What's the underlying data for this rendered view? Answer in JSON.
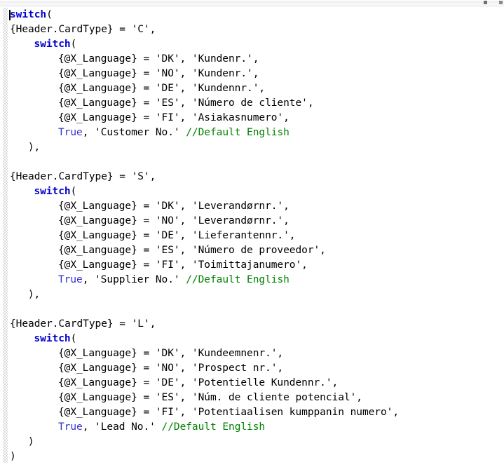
{
  "app": {
    "type": "code-editor",
    "language": "Crystal Reports formula",
    "colors": {
      "background": "#ffffff",
      "text": "#000000",
      "keyword": "#0000d0",
      "boolean": "#3333cc",
      "comment": "#008000",
      "gutter": "#d8d8d8"
    }
  },
  "chrome": {
    "mark_1": "",
    "mark_2": ""
  },
  "editor": {
    "caret_line": 1,
    "caret_column": 1,
    "lines": [
      {
        "n": 1,
        "indent": 0,
        "tokens": [
          {
            "t": "kw",
            "v": "switch"
          },
          {
            "t": "punc",
            "v": "("
          }
        ]
      },
      {
        "n": 2,
        "indent": 0,
        "tokens": [
          {
            "t": "fld",
            "v": "{Header.CardType} = 'C',"
          }
        ]
      },
      {
        "n": 3,
        "indent": 4,
        "tokens": [
          {
            "t": "kw",
            "v": "switch"
          },
          {
            "t": "punc",
            "v": "("
          }
        ]
      },
      {
        "n": 4,
        "indent": 8,
        "tokens": [
          {
            "t": "fld",
            "v": "{@X_Language} = 'DK', 'Kundenr.',"
          }
        ]
      },
      {
        "n": 5,
        "indent": 8,
        "tokens": [
          {
            "t": "fld",
            "v": "{@X_Language} = 'NO', 'Kundenr.',"
          }
        ]
      },
      {
        "n": 6,
        "indent": 8,
        "tokens": [
          {
            "t": "fld",
            "v": "{@X_Language} = 'DE', 'Kundennr.',"
          }
        ]
      },
      {
        "n": 7,
        "indent": 8,
        "tokens": [
          {
            "t": "fld",
            "v": "{@X_Language} = 'ES', 'Número de cliente',"
          }
        ]
      },
      {
        "n": 8,
        "indent": 8,
        "tokens": [
          {
            "t": "fld",
            "v": "{@X_Language} = 'FI', 'Asiakasnumero',"
          }
        ]
      },
      {
        "n": 9,
        "indent": 8,
        "tokens": [
          {
            "t": "bool",
            "v": "True"
          },
          {
            "t": "str",
            "v": ", 'Customer No.' "
          },
          {
            "t": "cmt",
            "v": "//Default English"
          }
        ]
      },
      {
        "n": 10,
        "indent": 3,
        "tokens": [
          {
            "t": "punc",
            "v": "),"
          }
        ]
      },
      {
        "n": 11,
        "indent": 0,
        "tokens": []
      },
      {
        "n": 12,
        "indent": 0,
        "tokens": [
          {
            "t": "fld",
            "v": "{Header.CardType} = 'S',"
          }
        ]
      },
      {
        "n": 13,
        "indent": 4,
        "tokens": [
          {
            "t": "kw",
            "v": "switch"
          },
          {
            "t": "punc",
            "v": "("
          }
        ]
      },
      {
        "n": 14,
        "indent": 8,
        "tokens": [
          {
            "t": "fld",
            "v": "{@X_Language} = 'DK', 'Leverandørnr.',"
          }
        ]
      },
      {
        "n": 15,
        "indent": 8,
        "tokens": [
          {
            "t": "fld",
            "v": "{@X_Language} = 'NO', 'Leverandørnr.',"
          }
        ]
      },
      {
        "n": 16,
        "indent": 8,
        "tokens": [
          {
            "t": "fld",
            "v": "{@X_Language} = 'DE', 'Lieferantennr.',"
          }
        ]
      },
      {
        "n": 17,
        "indent": 8,
        "tokens": [
          {
            "t": "fld",
            "v": "{@X_Language} = 'ES', 'Número de proveedor',"
          }
        ]
      },
      {
        "n": 18,
        "indent": 8,
        "tokens": [
          {
            "t": "fld",
            "v": "{@X_Language} = 'FI', 'Toimittajanumero',"
          }
        ]
      },
      {
        "n": 19,
        "indent": 8,
        "tokens": [
          {
            "t": "bool",
            "v": "True"
          },
          {
            "t": "str",
            "v": ", 'Supplier No.' "
          },
          {
            "t": "cmt",
            "v": "//Default English"
          }
        ]
      },
      {
        "n": 20,
        "indent": 3,
        "tokens": [
          {
            "t": "punc",
            "v": "),"
          }
        ]
      },
      {
        "n": 21,
        "indent": 0,
        "tokens": []
      },
      {
        "n": 22,
        "indent": 0,
        "tokens": [
          {
            "t": "fld",
            "v": "{Header.CardType} = 'L',"
          }
        ]
      },
      {
        "n": 23,
        "indent": 4,
        "tokens": [
          {
            "t": "kw",
            "v": "switch"
          },
          {
            "t": "punc",
            "v": "("
          }
        ]
      },
      {
        "n": 24,
        "indent": 8,
        "tokens": [
          {
            "t": "fld",
            "v": "{@X_Language} = 'DK', 'Kundeemnenr.',"
          }
        ]
      },
      {
        "n": 25,
        "indent": 8,
        "tokens": [
          {
            "t": "fld",
            "v": "{@X_Language} = 'NO', 'Prospect nr.',"
          }
        ]
      },
      {
        "n": 26,
        "indent": 8,
        "tokens": [
          {
            "t": "fld",
            "v": "{@X_Language} = 'DE', 'Potentielle Kundennr.',"
          }
        ]
      },
      {
        "n": 27,
        "indent": 8,
        "tokens": [
          {
            "t": "fld",
            "v": "{@X_Language} = 'ES', 'Núm. de cliente potencial',"
          }
        ]
      },
      {
        "n": 28,
        "indent": 8,
        "tokens": [
          {
            "t": "fld",
            "v": "{@X_Language} = 'FI', 'Potentiaalisen kumppanin numero',"
          }
        ]
      },
      {
        "n": 29,
        "indent": 8,
        "tokens": [
          {
            "t": "bool",
            "v": "True"
          },
          {
            "t": "str",
            "v": ", 'Lead No.' "
          },
          {
            "t": "cmt",
            "v": "//Default English"
          }
        ]
      },
      {
        "n": 30,
        "indent": 3,
        "tokens": [
          {
            "t": "punc",
            "v": ")"
          }
        ]
      },
      {
        "n": 31,
        "indent": 0,
        "tokens": [
          {
            "t": "punc",
            "v": ")"
          }
        ]
      }
    ]
  }
}
